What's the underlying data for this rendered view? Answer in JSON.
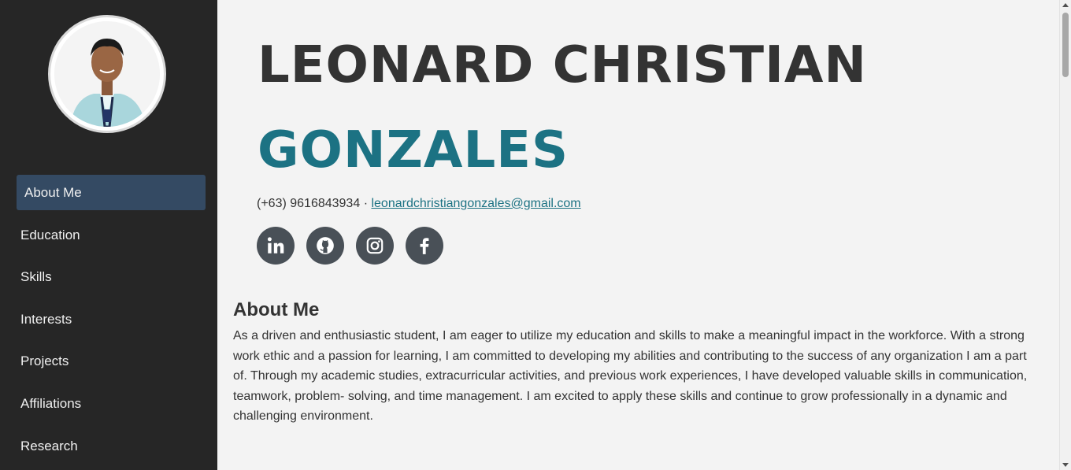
{
  "profile": {
    "first_name": "LEONARD CHRISTIAN",
    "last_name": "GONZALES",
    "phone": "(+63) 9616843934",
    "separator": "·",
    "email": "leonardchristiangonzales@gmail.com"
  },
  "sidebar": {
    "items": [
      {
        "label": "About Me"
      },
      {
        "label": "Education"
      },
      {
        "label": "Skills"
      },
      {
        "label": "Interests"
      },
      {
        "label": "Projects"
      },
      {
        "label": "Affiliations"
      },
      {
        "label": "Research"
      }
    ],
    "active_item": "About Me"
  },
  "socials": [
    "linkedin-icon",
    "github-icon",
    "instagram-icon",
    "facebook-icon"
  ],
  "about": {
    "title": "About Me",
    "text": "As a driven and enthusiastic student, I am eager to utilize my education and skills to make a meaningful impact in the workforce. With a strong work ethic and a passion for learning, I am committed to developing my abilities and contributing to the success of any organization I am a part of. Through my academic studies, extracurricular activities, and previous work experiences, I have developed valuable skills in communication, teamwork, problem- solving, and time management. I am excited to apply these skills and continue to grow professionally in a dynamic and challenging environment."
  },
  "colors": {
    "sidebar_bg": "#262626",
    "active_nav_bg": "#344a63",
    "accent": "#1c7283",
    "social_bg": "#495057"
  }
}
